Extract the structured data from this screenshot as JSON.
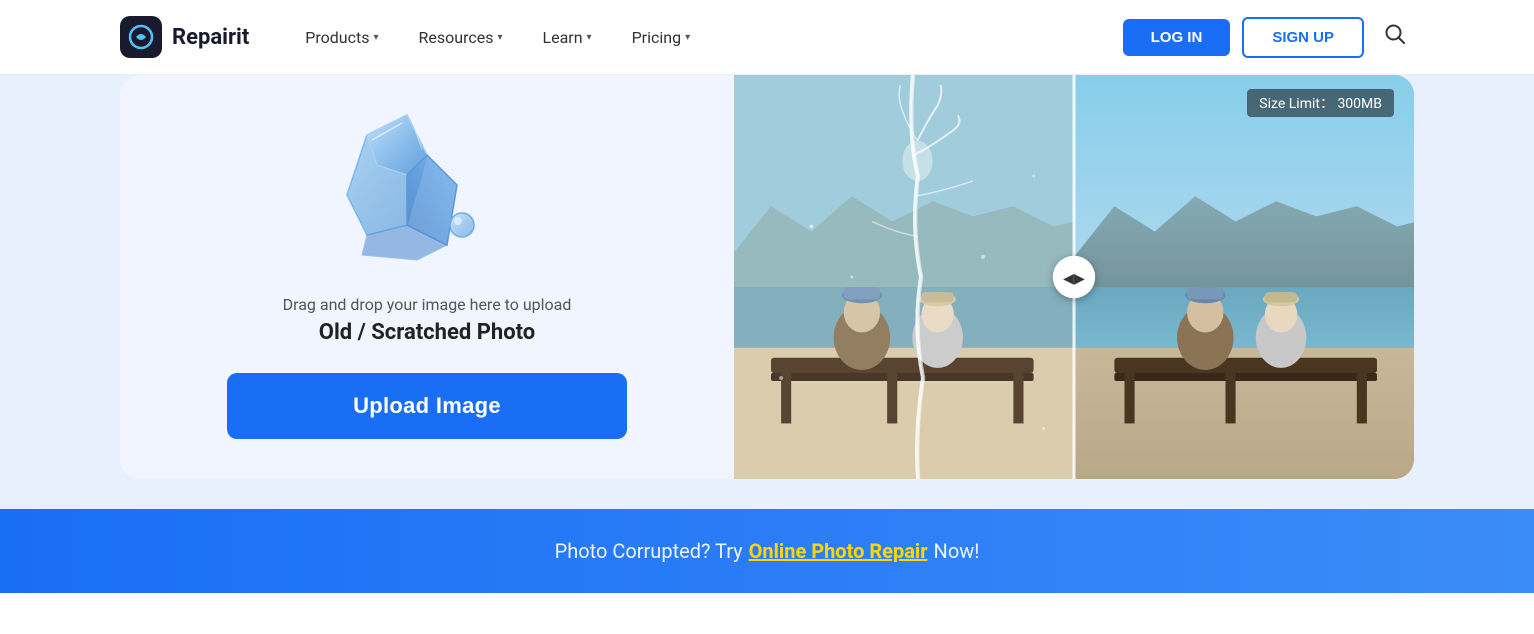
{
  "navbar": {
    "logo_text": "Repairit",
    "nav_items": [
      {
        "label": "Products",
        "has_dropdown": true
      },
      {
        "label": "Resources",
        "has_dropdown": true
      },
      {
        "label": "Learn",
        "has_dropdown": true
      },
      {
        "label": "Pricing",
        "has_dropdown": true
      }
    ],
    "login_label": "LOG IN",
    "signup_label": "SIGN UP"
  },
  "upload_panel": {
    "drag_text": "Drag and drop your image here to upload",
    "photo_type": "Old / Scratched Photo",
    "upload_button_label": "Upload Image"
  },
  "preview_panel": {
    "size_limit_label": "Size Limit：",
    "size_limit_value": "300MB"
  },
  "bottom_banner": {
    "text_start": "Photo Corrupted?  Try ",
    "link_text": "Online Photo Repair",
    "text_end": " Now!"
  },
  "icons": {
    "chevron": "▾",
    "search": "🔍",
    "slider_arrows": "◀▶"
  }
}
